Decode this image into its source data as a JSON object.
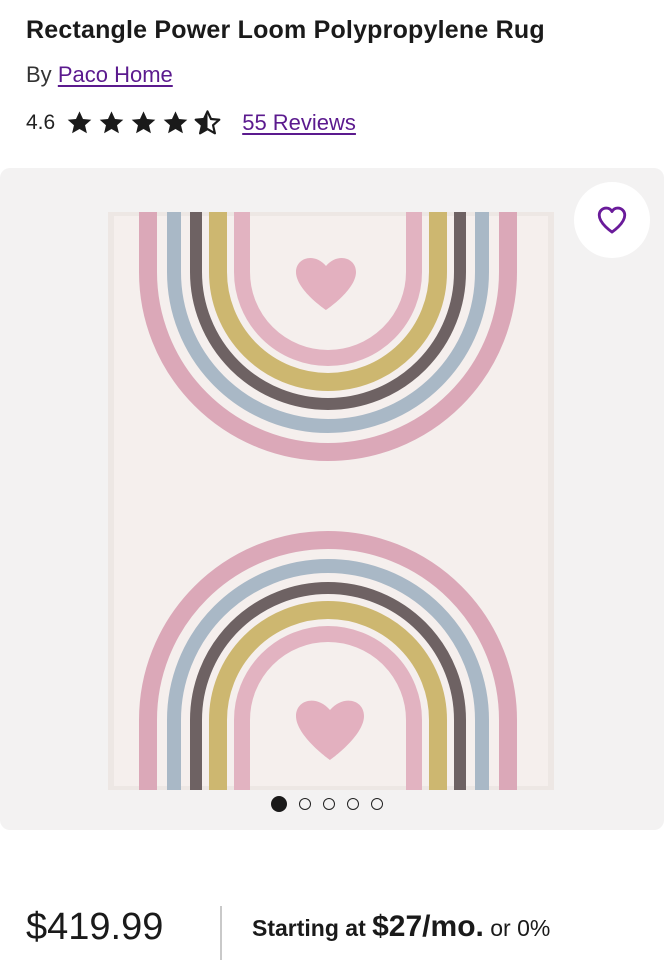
{
  "product": {
    "title": "Rectangle Power Loom Polypropylene Rug",
    "by_label": "By",
    "brand": "Paco Home",
    "rating": "4.6",
    "rating_value": 4.6,
    "star_icons": [
      "star-full-icon",
      "star-full-icon",
      "star-full-icon",
      "star-full-icon",
      "star-half-icon"
    ],
    "reviews_label": "55 Reviews"
  },
  "gallery": {
    "favorite_icon": "heart-outline-icon",
    "image_count": 5,
    "active_index": 0
  },
  "pricing": {
    "price": "$419.99",
    "financing_lead": "Starting at",
    "financing_amount": "$27/mo.",
    "financing_tail": "or 0%"
  },
  "colors": {
    "link": "#5b1a8e",
    "accent_purple": "#6a1b9a",
    "gallery_bg": "#f3f2f2",
    "star": "#1a1a1a"
  }
}
